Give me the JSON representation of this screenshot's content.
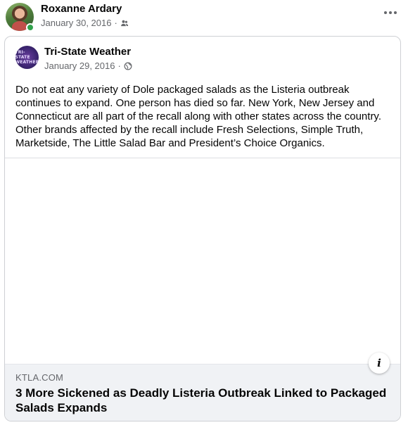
{
  "post": {
    "author": "Roxanne Ardary",
    "date": "January 30, 2016",
    "separator": "·",
    "audience_icon": "friends-icon",
    "more_icon": "more-options-icon"
  },
  "shared": {
    "page_name": "Tri-State Weather",
    "page_avatar_text": "TRI-STATE WEATHER",
    "date": "January 29, 2016",
    "separator": "·",
    "audience_icon": "globe-icon",
    "text": "Do not eat any variety of Dole packaged salads as the Listeria outbreak continues to expand. One person has died so far. New York, New Jersey and Connecticut are all part of the recall along with other states across the country. Other brands affected by the recall include Fresh Selections, Simple Truth, Marketside, The Little Salad Bar and President’s Choice Organics."
  },
  "link": {
    "domain": "KTLA.COM",
    "title": "3 More Sickened as Deadly Listeria Outbreak Linked to Packaged Salads Expands",
    "info_label": "i"
  },
  "colors": {
    "online": "#31a24c",
    "secondary_text": "#65676b",
    "link_footer_bg": "#f0f2f5"
  }
}
